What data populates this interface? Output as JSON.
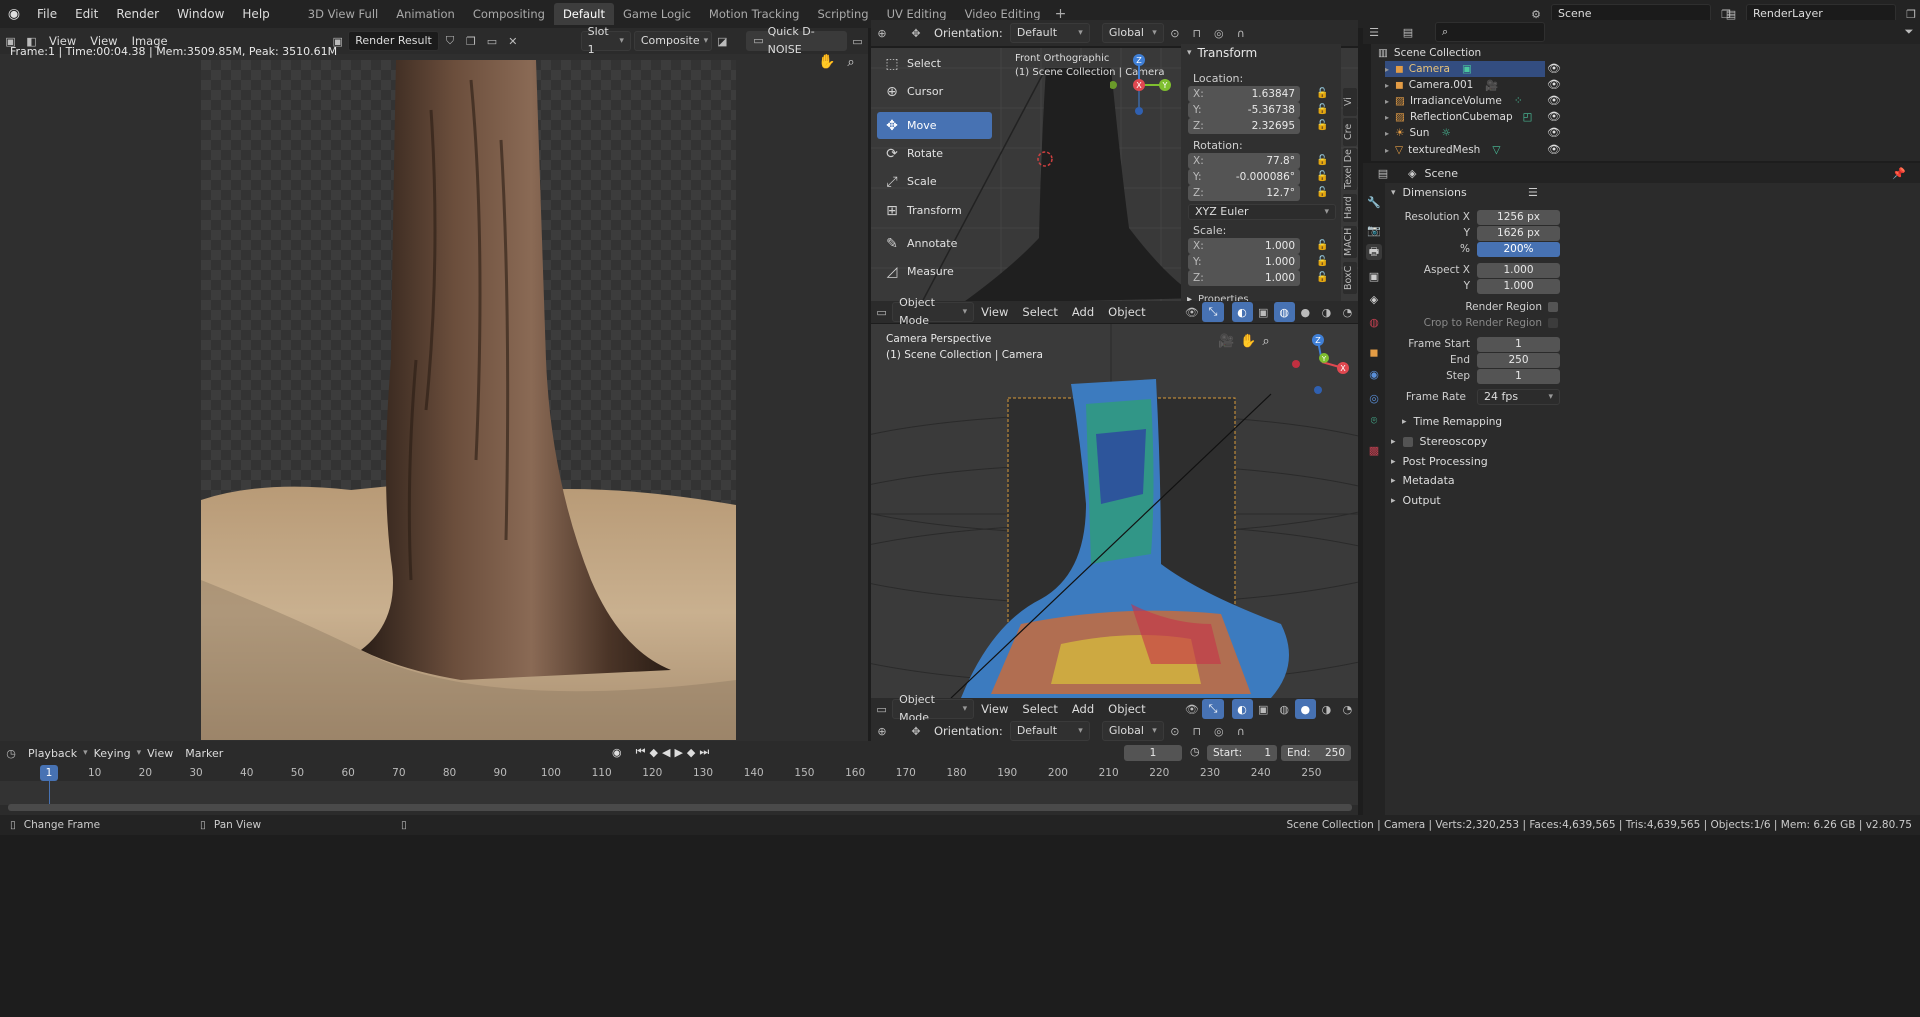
{
  "topbar": {
    "menus": [
      "File",
      "Edit",
      "Render",
      "Window",
      "Help"
    ],
    "workspaces": [
      "3D View Full",
      "Animation",
      "Compositing",
      "Default",
      "Game Logic",
      "Motion Tracking",
      "Scripting",
      "UV Editing",
      "Video Editing"
    ],
    "active_workspace": "Default",
    "add_tab": "+",
    "scene": "Scene",
    "view_layer": "RenderLayer"
  },
  "image_editor": {
    "menus": [
      "View",
      "View",
      "Image"
    ],
    "image_name": "Render Result",
    "slot": "Slot 1",
    "pass": "Composite",
    "denoise": "Quick D-NOISE",
    "info": "Frame:1 | Time:00:04.38 | Mem:3509.85M, Peak: 3510.61M"
  },
  "viewport_header_top": {
    "orientation_label": "Orientation:",
    "orientation": "Default",
    "transform_space": "Global"
  },
  "viewport_top": {
    "overlay_title": "Front Orthographic",
    "overlay_sub": "(1) Scene Collection | Camera",
    "mode": "Object Mode",
    "menus": [
      "View",
      "Select",
      "Add",
      "Object"
    ]
  },
  "tools": [
    {
      "label": "Select",
      "icon": "▭"
    },
    {
      "label": "Cursor",
      "icon": "⊕"
    },
    {
      "label": "Move",
      "icon": "✥"
    },
    {
      "label": "Rotate",
      "icon": "⟳"
    },
    {
      "label": "Scale",
      "icon": "⤢"
    },
    {
      "label": "Transform",
      "icon": "⊞"
    },
    {
      "label": "Annotate",
      "icon": "✎"
    },
    {
      "label": "Measure",
      "icon": "📐"
    }
  ],
  "active_tool": "Move",
  "npanel": {
    "title": "Transform",
    "location_label": "Location:",
    "location": [
      {
        "axis": "X:",
        "value": "1.63847"
      },
      {
        "axis": "Y:",
        "value": "-5.36738"
      },
      {
        "axis": "Z:",
        "value": "2.32695"
      }
    ],
    "rotation_label": "Rotation:",
    "rotation": [
      {
        "axis": "X:",
        "value": "77.8°"
      },
      {
        "axis": "Y:",
        "value": "-0.000086°"
      },
      {
        "axis": "Z:",
        "value": "12.7°"
      }
    ],
    "rotation_mode": "XYZ Euler",
    "scale_label": "Scale:",
    "scale": [
      {
        "axis": "X:",
        "value": "1.000"
      },
      {
        "axis": "Y:",
        "value": "1.000"
      },
      {
        "axis": "Z:",
        "value": "1.000"
      }
    ],
    "next_section": "Properties",
    "tabs": [
      "Vi",
      "Cre",
      "Texel De",
      "Hard",
      "MACH",
      "BoxC"
    ]
  },
  "viewport_cam": {
    "overlay_title": "Camera Perspective",
    "overlay_sub": "(1) Scene Collection | Camera",
    "mode": "Object Mode",
    "menus": [
      "View",
      "Select",
      "Add",
      "Object"
    ],
    "orientation_label": "Orientation:",
    "orientation": "Default",
    "transform_space": "Global"
  },
  "outliner": {
    "root": "Scene Collection",
    "items": [
      {
        "name": "Camera",
        "color": "#e39c45"
      },
      {
        "name": "Camera.001",
        "color": "#e39c45"
      },
      {
        "name": "IrradianceVolume",
        "color": "#e39c45"
      },
      {
        "name": "ReflectionCubemap",
        "color": "#e39c45"
      },
      {
        "name": "Sun",
        "color": "#e39c45"
      },
      {
        "name": "texturedMesh",
        "color": "#e39c45"
      }
    ]
  },
  "properties": {
    "context": "Scene",
    "dimensions_title": "Dimensions",
    "resolution_x_label": "Resolution X",
    "resolution_x": "1256 px",
    "resolution_y_label": "Y",
    "resolution_y": "1626 px",
    "percent_label": "%",
    "percent": "200%",
    "aspect_x_label": "Aspect X",
    "aspect_x": "1.000",
    "aspect_y_label": "Y",
    "aspect_y": "1.000",
    "render_region": "Render Region",
    "crop_region": "Crop to Render Region",
    "frame_start_label": "Frame Start",
    "frame_start": "1",
    "end_label": "End",
    "end": "250",
    "step_label": "Step",
    "step": "1",
    "frame_rate_label": "Frame Rate",
    "frame_rate": "24 fps",
    "time_remapping": "Time Remapping",
    "stereoscopy": "Stereoscopy",
    "post_processing": "Post Processing",
    "metadata": "Metadata",
    "output": "Output"
  },
  "timeline": {
    "menus": [
      "Playback",
      "Keying",
      "View",
      "Marker"
    ],
    "current_frame": "1",
    "start_label": "Start:",
    "start": "1",
    "end_label": "End:",
    "end": "250",
    "ticks": [
      "10",
      "20",
      "30",
      "40",
      "50",
      "60",
      "70",
      "80",
      "90",
      "100",
      "110",
      "120",
      "130",
      "140",
      "150",
      "160",
      "170",
      "180",
      "190",
      "200",
      "210",
      "220",
      "230",
      "240",
      "250"
    ],
    "cursor_label": "1"
  },
  "statusbar": {
    "left": "Change Frame",
    "middle": "Pan View",
    "right": "Scene Collection | Camera | Verts:2,320,253 | Faces:4,639,565 | Tris:4,639,565 | Objects:1/6 | Mem: 6.26 GB | v2.80.75"
  }
}
